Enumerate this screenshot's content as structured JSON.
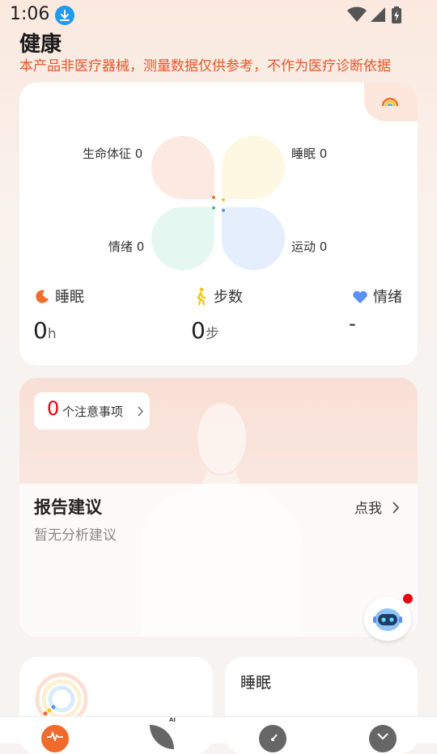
{
  "status_bar": {
    "time": "1:06"
  },
  "page": {
    "title": "健康",
    "disclaimer": "本产品非医疗器械，测量数据仅供参考，不作为医疗诊断依据"
  },
  "overview": {
    "quadrants": [
      {
        "label": "生命体征",
        "value": "0",
        "color": "#fce9e2"
      },
      {
        "label": "睡眠",
        "value": "0",
        "color": "#fdf8e1"
      },
      {
        "label": "情绪",
        "value": "0",
        "color": "#e4f7f0"
      },
      {
        "label": "运动",
        "value": "0",
        "color": "#e4eefc"
      }
    ],
    "metrics": [
      {
        "label": "睡眠",
        "value": "0",
        "unit": "h",
        "icon": "sleep-moon-icon",
        "color": "#f26b2a"
      },
      {
        "label": "步数",
        "value": "0",
        "unit": "步",
        "icon": "walking-person-icon",
        "color": "#f2c81d"
      },
      {
        "label": "情绪",
        "value": "-",
        "unit": "",
        "icon": "heart-icon",
        "color": "#5b8ff5"
      }
    ]
  },
  "report": {
    "attention_count": "0",
    "attention_label": "个注意事项",
    "title": "报告建议",
    "subtitle": "暂无分析建议",
    "link": "点我"
  },
  "sleep_card": {
    "title": "睡眠"
  },
  "colors": {
    "accent": "#e8562b",
    "alert": "#e60012"
  }
}
